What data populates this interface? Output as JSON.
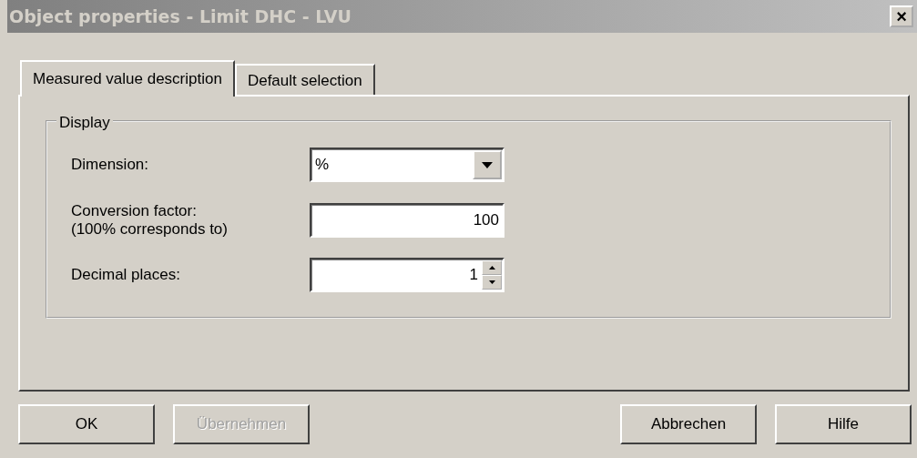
{
  "window": {
    "title": "Object properties - Limit DHC - LVU",
    "close": "×"
  },
  "tabs": [
    {
      "label": "Measured value description",
      "selected": true
    },
    {
      "label": "Default selection",
      "selected": false
    }
  ],
  "group": {
    "legend": "Display"
  },
  "fields": [
    {
      "kind": "combo",
      "label": "Dimension:",
      "value": "%"
    },
    {
      "kind": "text",
      "label": "Conversion factor:\n(100% corresponds to)",
      "value": "100"
    },
    {
      "kind": "spin",
      "label": "Decimal places:",
      "value": "1"
    }
  ],
  "buttons": [
    {
      "label": "OK",
      "disabled": false
    },
    {
      "label": "Übernehmen",
      "disabled": true
    },
    {
      "label": "Abbrechen",
      "disabled": false
    },
    {
      "label": "Hilfe",
      "disabled": false
    }
  ]
}
